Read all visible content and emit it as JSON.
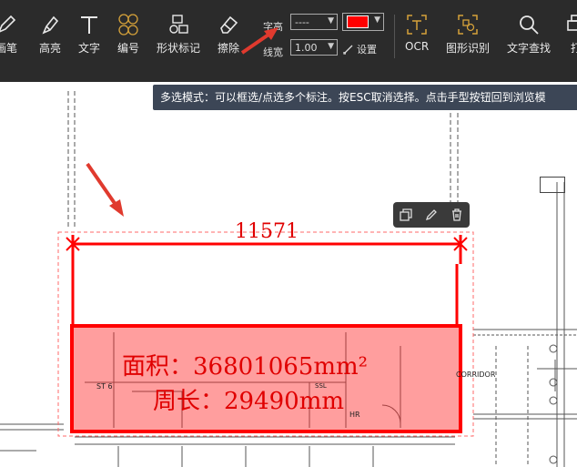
{
  "toolbar": {
    "tools": [
      {
        "name": "draw",
        "label": "画笔"
      },
      {
        "name": "highlight",
        "label": "高亮"
      },
      {
        "name": "text",
        "label": "文字"
      },
      {
        "name": "number",
        "label": "编号"
      },
      {
        "name": "shape-mark",
        "label": "形状标记"
      },
      {
        "name": "erase",
        "label": "擦除"
      }
    ],
    "font_height_label": "字高",
    "font_height_value": "----",
    "line_width_label": "线宽",
    "line_width_value": "1.00",
    "settings_label": "设置",
    "color": "#ff0000",
    "right_tools": [
      {
        "name": "ocr",
        "label": "OCR"
      },
      {
        "name": "shape-recognition",
        "label": "图形识别"
      },
      {
        "name": "text-search",
        "label": "文字查找"
      },
      {
        "name": "print",
        "label": "打"
      }
    ]
  },
  "tooltip": "多选模式：可以框选/点选多个标注。按ESC取消选择。点击手型按钮回到浏览模",
  "annotations": {
    "dimension": "11571",
    "area": "面积：36801065mm²",
    "perimeter": "周长：29490mm"
  },
  "drawing_labels": {
    "room1": "ST 6",
    "room2": "SSL",
    "room3": "HR",
    "corridor": "CORRIDOR"
  },
  "colors": {
    "accent": "#ff0000",
    "toolbar_bg": "#2b2b2b",
    "tooltip_bg": "#3c4656"
  }
}
